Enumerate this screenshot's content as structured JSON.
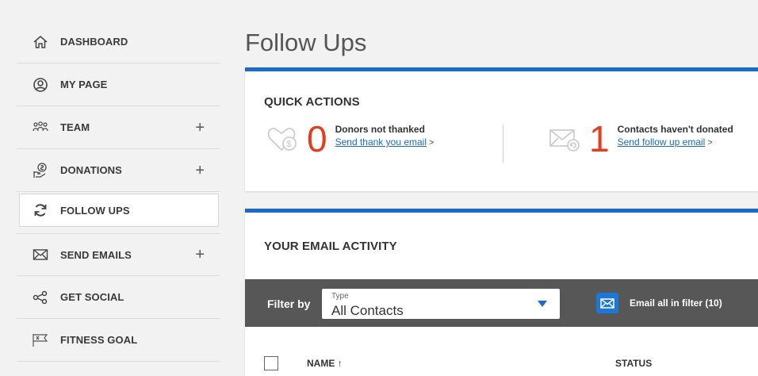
{
  "sidebar": {
    "items": [
      {
        "label": "DASHBOARD",
        "icon": "home-icon",
        "expandable": false
      },
      {
        "label": "MY PAGE",
        "icon": "user-circle-icon",
        "expandable": false
      },
      {
        "label": "TEAM",
        "icon": "team-icon",
        "expandable": true
      },
      {
        "label": "DONATIONS",
        "icon": "donation-hand-icon",
        "expandable": true
      },
      {
        "label": "FOLLOW UPS",
        "icon": "refresh-icon",
        "expandable": false,
        "active": true
      },
      {
        "label": "SEND EMAILS",
        "icon": "envelope-icon",
        "expandable": true
      },
      {
        "label": "GET SOCIAL",
        "icon": "share-icon",
        "expandable": false
      },
      {
        "label": "FITNESS GOAL",
        "icon": "flag-icon",
        "expandable": false
      }
    ],
    "expand_symbol": "+"
  },
  "main": {
    "title": "Follow Ups",
    "quick_actions": {
      "title": "QUICK ACTIONS",
      "items": [
        {
          "count": "0",
          "label": "Donors not thanked",
          "link": "Send thank you email",
          "chevron": ">",
          "icon": "heart-dollar-icon"
        },
        {
          "count": "1",
          "label": "Contacts haven't donated",
          "link": "Send follow up email",
          "chevron": ">",
          "icon": "envelope-arrow-icon"
        }
      ]
    },
    "email_activity": {
      "title": "YOUR EMAIL ACTIVITY",
      "filter_by": "Filter by",
      "type_label": "Type",
      "type_value": "All Contacts",
      "email_all": "Email all in filter (10)",
      "columns": {
        "name": "NAME",
        "sort_arrow": "↑",
        "status": "STATUS"
      }
    }
  },
  "colors": {
    "accent": "#1b6ac9",
    "count": "#e33d1e",
    "filterbar": "#575757"
  }
}
